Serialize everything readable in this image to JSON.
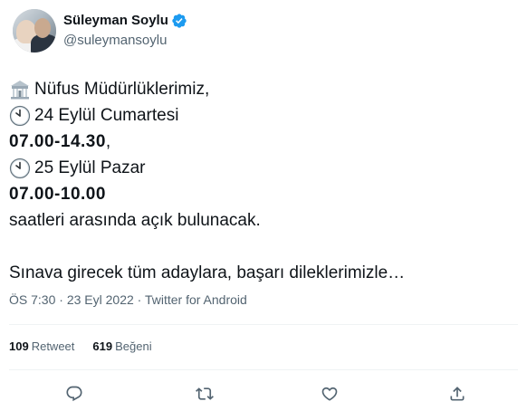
{
  "author": {
    "display_name": "Süleyman Soylu",
    "handle": "@suleymansoylu",
    "verified": true
  },
  "tweet": {
    "lines": [
      {
        "icon": "government-building-icon",
        "text": "Nüfus Müdürlüklerimiz,",
        "bold": false
      },
      {
        "icon": "clock-icon",
        "text": " 24 Eylül Cumartesi",
        "bold": false
      },
      {
        "icon": "",
        "text": "07.00-14.30",
        "bold": true,
        "suffix": ","
      },
      {
        "icon": "clock-icon",
        "text": " 25 Eylül Pazar",
        "bold": false
      },
      {
        "icon": "",
        "text": "07.00-10.00",
        "bold": true
      },
      {
        "icon": "",
        "text": "saatleri arasında açık bulunacak.",
        "bold": false
      },
      {
        "icon": "",
        "text": "",
        "bold": false
      },
      {
        "icon": "",
        "text": "Sınava girecek tüm adaylara, başarı dileklerimizle…",
        "bold": false
      }
    ]
  },
  "meta": {
    "time": "ÖS 7:30",
    "separator": " · ",
    "date": "23 Eyl 2022",
    "source": "Twitter for Android"
  },
  "stats": {
    "retweets_count": "109",
    "retweets_label": "Retweet",
    "likes_count": "619",
    "likes_label": "Beğeni"
  },
  "actions": [
    "reply-icon",
    "retweet-icon",
    "like-icon",
    "share-icon"
  ],
  "colors": {
    "text": "#0f1419",
    "secondary": "#536471",
    "verified": "#1d9bf0",
    "divider": "#eff3f4"
  }
}
